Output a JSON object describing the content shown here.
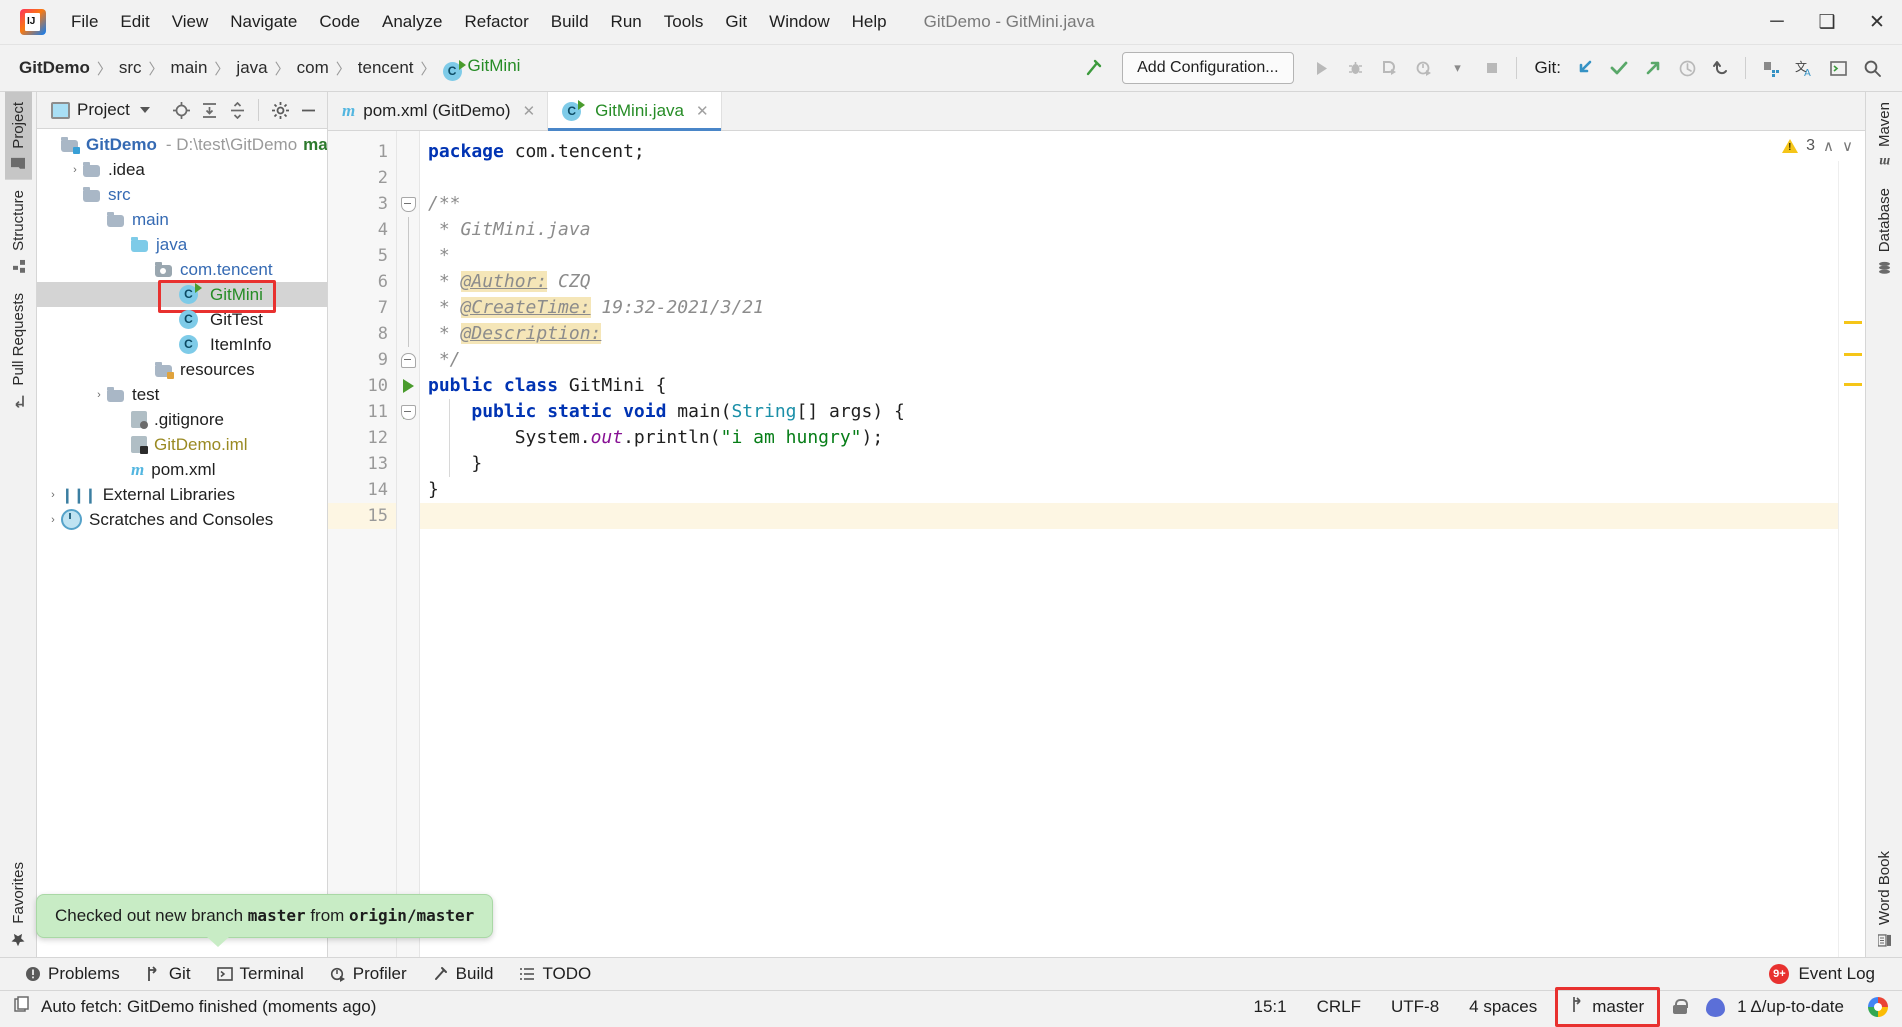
{
  "window": {
    "title": "GitDemo - GitMini.java",
    "minimize": "─",
    "maximize": "❑",
    "close": "✕"
  },
  "menu": [
    {
      "label": "File"
    },
    {
      "label": "Edit"
    },
    {
      "label": "View"
    },
    {
      "label": "Navigate"
    },
    {
      "label": "Code"
    },
    {
      "label": "Analyze"
    },
    {
      "label": "Refactor"
    },
    {
      "label": "Build"
    },
    {
      "label": "Run"
    },
    {
      "label": "Tools"
    },
    {
      "label": "Git"
    },
    {
      "label": "Window"
    },
    {
      "label": "Help"
    }
  ],
  "breadcrumb": {
    "items": [
      "GitDemo",
      "src",
      "main",
      "java",
      "com",
      "tencent",
      "GitMini"
    ],
    "separator": "〉"
  },
  "toolbar": {
    "build_hammer": "build-icon",
    "add_configuration": "Add Configuration...",
    "run": "▶",
    "debug": "debug-icon",
    "run_coverage": "coverage-icon",
    "profile": "profile-icon",
    "dropdown": "▾",
    "stop": "■",
    "git_label": "Git:",
    "git_update": "update-project-icon",
    "git_commit": "✓",
    "git_push": "↗",
    "git_history": "◴",
    "git_rollback": "↺",
    "structure_search": "ⓘ",
    "translate": "translate-icon",
    "terminal": "terminal-icon",
    "search": "⌕"
  },
  "left_rail": {
    "top": [
      {
        "label": "Project",
        "icon": "folder-icon",
        "selected": true
      },
      {
        "label": "Structure",
        "icon": "structure-icon",
        "selected": false
      },
      {
        "label": "Pull Requests",
        "icon": "pull-request-icon",
        "selected": false
      }
    ],
    "bottom": [
      {
        "label": "Favorites",
        "icon": "star-icon",
        "selected": false
      }
    ]
  },
  "right_rail": [
    {
      "label": "Maven",
      "icon": "maven-icon"
    },
    {
      "label": "Database",
      "icon": "database-icon"
    },
    {
      "label": "Word Book",
      "icon": "wordbook-icon"
    }
  ],
  "project_panel": {
    "title": "Project",
    "dropdown": "▾",
    "actions": [
      "locate-icon",
      "expand-all-icon",
      "collapse-all-icon",
      "settings-gear-icon",
      "hide-icon"
    ],
    "tree": [
      {
        "indent": 0,
        "arrow": "ⱟ",
        "icon": "module-folder",
        "label": "GitDemo",
        "style": "bold-blue",
        "path": "- D:\\test\\GitDemo",
        "branch": "master",
        "selected": false
      },
      {
        "indent": 1,
        "arrow": "›",
        "icon": "folder",
        "label": ".idea",
        "style": "plain",
        "selected": false
      },
      {
        "indent": 1,
        "arrow": "ⱟ",
        "icon": "folder",
        "label": "src",
        "style": "blue",
        "selected": false
      },
      {
        "indent": 2,
        "arrow": "ⱟ",
        "icon": "folder",
        "label": "main",
        "style": "blue",
        "selected": false
      },
      {
        "indent": 3,
        "arrow": "ⱟ",
        "icon": "folder-blue",
        "label": "java",
        "style": "blue",
        "selected": false
      },
      {
        "indent": 4,
        "arrow": "ⱟ",
        "icon": "package",
        "label": "com.tencent",
        "style": "blue",
        "selected": false
      },
      {
        "indent": 5,
        "arrow": "",
        "icon": "class-runnable",
        "label": "GitMini",
        "style": "green",
        "selected": true,
        "highlight": true
      },
      {
        "indent": 5,
        "arrow": "",
        "icon": "class",
        "label": "GitTest",
        "style": "plain",
        "selected": false
      },
      {
        "indent": 5,
        "arrow": "",
        "icon": "class",
        "label": "ItemInfo",
        "style": "plain",
        "selected": false
      },
      {
        "indent": 4,
        "arrow": "",
        "icon": "folder-resources",
        "label": "resources",
        "style": "plain",
        "selected": false
      },
      {
        "indent": 2,
        "arrow": "›",
        "icon": "folder",
        "label": "test",
        "style": "plain",
        "selected": false
      },
      {
        "indent": 2,
        "arrow": "",
        "icon": "file-ignored",
        "label": ".gitignore",
        "style": "plain",
        "selected": false
      },
      {
        "indent": 2,
        "arrow": "",
        "icon": "file-iml",
        "label": "GitDemo.iml",
        "style": "olive",
        "selected": false
      },
      {
        "indent": 2,
        "arrow": "",
        "icon": "maven-file",
        "label": "pom.xml",
        "style": "plain",
        "selected": false
      },
      {
        "indent": 0,
        "arrow": "›",
        "icon": "libraries",
        "label": "External Libraries",
        "style": "plain",
        "selected": false
      },
      {
        "indent": 0,
        "arrow": "›",
        "icon": "scratches",
        "label": "Scratches and Consoles",
        "style": "plain",
        "selected": false
      }
    ]
  },
  "editor": {
    "tabs": [
      {
        "label": "pom.xml (GitDemo)",
        "icon": "maven-file-icon",
        "active": false,
        "close": "✕"
      },
      {
        "label": "GitMini.java",
        "icon": "java-class-runnable-icon",
        "active": true,
        "close": "✕"
      }
    ],
    "inspection": {
      "warning_count": "3",
      "warning_icon": "warning-triangle-icon",
      "up": "∧",
      "down": "∨"
    },
    "line_numbers": [
      "1",
      "2",
      "3",
      "4",
      "5",
      "6",
      "7",
      "8",
      "9",
      "10",
      "11",
      "12",
      "13",
      "14",
      "15"
    ],
    "current_line": 15,
    "lines": [
      {
        "n": 1,
        "tokens": [
          {
            "t": "package ",
            "c": "kw"
          },
          {
            "t": "com.tencent;",
            "c": "pln"
          }
        ]
      },
      {
        "n": 2,
        "tokens": []
      },
      {
        "n": 3,
        "tokens": [
          {
            "t": "/**",
            "c": "cmt"
          }
        ]
      },
      {
        "n": 4,
        "tokens": [
          {
            "t": " * GitMini.java",
            "c": "cmt"
          }
        ]
      },
      {
        "n": 5,
        "tokens": [
          {
            "t": " *",
            "c": "cmt"
          }
        ]
      },
      {
        "n": 6,
        "tokens": [
          {
            "t": " * ",
            "c": "cmt"
          },
          {
            "t": "@Author:",
            "c": "tag"
          },
          {
            "t": " CZQ",
            "c": "cmt"
          }
        ]
      },
      {
        "n": 7,
        "tokens": [
          {
            "t": " * ",
            "c": "cmt"
          },
          {
            "t": "@CreateTime:",
            "c": "tag"
          },
          {
            "t": " 19:32-2021/3/21",
            "c": "cmt"
          }
        ]
      },
      {
        "n": 8,
        "tokens": [
          {
            "t": " * ",
            "c": "cmt"
          },
          {
            "t": "@Description:",
            "c": "tag"
          }
        ]
      },
      {
        "n": 9,
        "tokens": [
          {
            "t": " */",
            "c": "cmt"
          }
        ]
      },
      {
        "n": 10,
        "tokens": [
          {
            "t": "public class ",
            "c": "kw"
          },
          {
            "t": "GitMini ",
            "c": "pln"
          },
          {
            "t": "{",
            "c": "pln"
          }
        ]
      },
      {
        "n": 11,
        "tokens": [
          {
            "t": "    ",
            "c": "pln"
          },
          {
            "t": "public static void ",
            "c": "kw"
          },
          {
            "t": "main",
            "c": "pln"
          },
          {
            "t": "(",
            "c": "pln"
          },
          {
            "t": "String",
            "c": "type"
          },
          {
            "t": "[] args) {",
            "c": "pln"
          }
        ]
      },
      {
        "n": 12,
        "tokens": [
          {
            "t": "        System.",
            "c": "pln"
          },
          {
            "t": "out",
            "c": "stat"
          },
          {
            "t": ".println(",
            "c": "pln"
          },
          {
            "t": "\"i am hungry\"",
            "c": "str"
          },
          {
            "t": ");",
            "c": "pln"
          }
        ]
      },
      {
        "n": 13,
        "tokens": [
          {
            "t": "    }",
            "c": "pln"
          }
        ]
      },
      {
        "n": 14,
        "tokens": [
          {
            "t": "}",
            "c": "pln"
          }
        ]
      },
      {
        "n": 15,
        "tokens": []
      }
    ],
    "run_markers": [
      10,
      11
    ]
  },
  "tooltip": {
    "prefix": "Checked out new branch ",
    "branch": "master",
    "middle": " from ",
    "remote": "origin/master"
  },
  "tool_windows": [
    {
      "label": "Problems",
      "icon": "problems-icon"
    },
    {
      "label": "Git",
      "icon": "git-branch-icon"
    },
    {
      "label": "Terminal",
      "icon": "terminal-icon"
    },
    {
      "label": "Profiler",
      "icon": "profiler-icon"
    },
    {
      "label": "Build",
      "icon": "build-hammer-icon"
    },
    {
      "label": "TODO",
      "icon": "todo-list-icon"
    }
  ],
  "event_log": {
    "label": "Event Log",
    "badge": "9+"
  },
  "status_bar": {
    "message": "Auto fetch: GitDemo finished (moments ago)",
    "message_icon": "copy-icon",
    "caret_position": "15:1",
    "line_separator": "CRLF",
    "encoding": "UTF-8",
    "indent": "4 spaces",
    "branch": "master",
    "branch_icon": "ᵞ",
    "lock_icon": "read-only-lock-icon",
    "inspection_widget": "1 Δ/up-to-date",
    "browser_icon": "chrome-icon"
  },
  "colors": {
    "accent_blue": "#4a86c8",
    "green_text": "#268c26",
    "red_highlight": "#e8312f",
    "tooltip_green": "#c8ecc5",
    "warning_yellow": "#f5c518",
    "keyword_blue": "#0033b3",
    "string_green": "#067d17"
  }
}
